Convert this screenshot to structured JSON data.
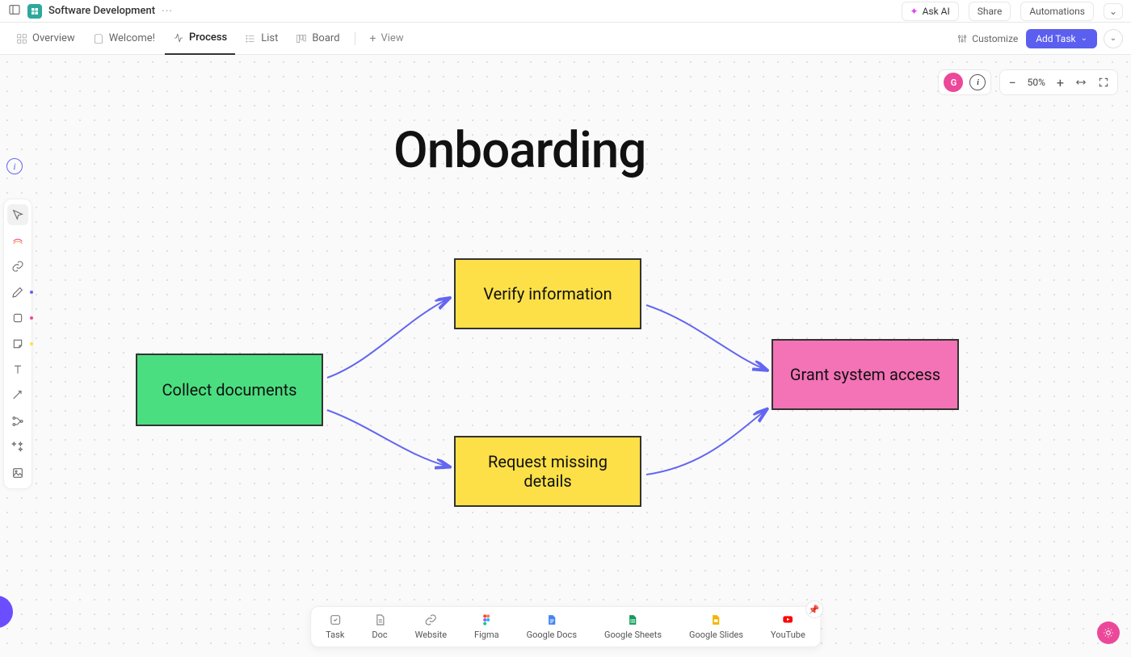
{
  "header": {
    "space_title": "Software Development"
  },
  "top_actions": {
    "ask_ai": "Ask AI",
    "share": "Share",
    "automations": "Automations"
  },
  "tabs": {
    "overview": "Overview",
    "welcome": "Welcome!",
    "process": "Process",
    "list": "List",
    "board": "Board",
    "view": "View",
    "customize": "Customize",
    "add_task": "Add Task"
  },
  "avatar": {
    "initial": "G"
  },
  "zoom": {
    "label": "50%"
  },
  "diagram": {
    "title": "Onboarding",
    "nodes": {
      "collect": "Collect documents",
      "verify": "Verify information",
      "request": "Request missing details",
      "grant": "Grant system access"
    }
  },
  "dock": {
    "task": "Task",
    "doc": "Doc",
    "website": "Website",
    "figma": "Figma",
    "gdocs": "Google Docs",
    "gsheets": "Google Sheets",
    "gslides": "Google Slides",
    "youtube": "YouTube"
  }
}
